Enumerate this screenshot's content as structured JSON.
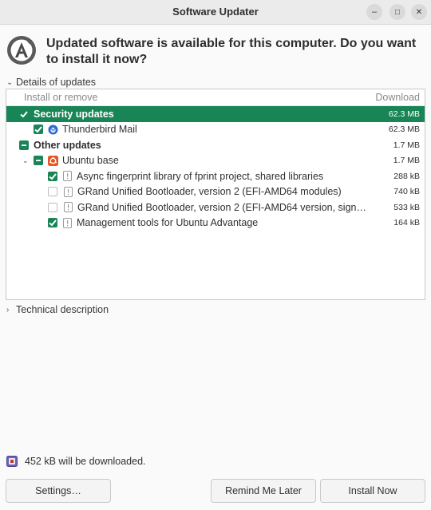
{
  "window": {
    "title": "Software Updater",
    "minimize_glyph": "–",
    "maximize_glyph": "□",
    "close_glyph": "✕"
  },
  "headline": "Updated software is available for this computer. Do you want to install it now?",
  "details_expander": "Details of updates",
  "tree": {
    "column_left": "Install or remove",
    "column_right": "Download",
    "rows": [
      {
        "label": "Security updates",
        "size": "62.3 MB"
      },
      {
        "label": "Thunderbird Mail",
        "size": "62.3 MB"
      },
      {
        "label": "Other updates",
        "size": "1.7 MB"
      },
      {
        "label": "Ubuntu base",
        "size": "1.7 MB"
      },
      {
        "label": "Async fingerprint library of fprint project, shared libraries",
        "size": "288 kB"
      },
      {
        "label": "GRand Unified Bootloader, version 2 (EFI-AMD64 modules)",
        "size": "740 kB"
      },
      {
        "label": "GRand Unified Bootloader, version 2 (EFI-AMD64 version, sign…",
        "size": "533 kB"
      },
      {
        "label": "Management tools for Ubuntu Advantage",
        "size": "164 kB"
      }
    ]
  },
  "technical_expander": "Technical description",
  "status": "452 kB will be downloaded.",
  "buttons": {
    "settings": "Settings…",
    "remind": "Remind Me Later",
    "install": "Install Now"
  },
  "colors": {
    "accent": "#198556",
    "ubuntu_orange": "#e95420"
  }
}
